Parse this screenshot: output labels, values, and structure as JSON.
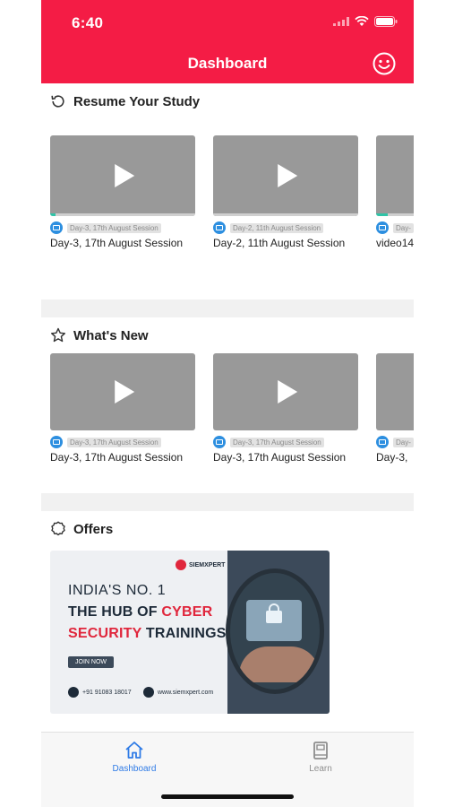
{
  "status_bar": {
    "time": "6:40"
  },
  "header": {
    "title": "Dashboard",
    "profile_icon": "smiley-icon"
  },
  "colors": {
    "header_bg": "#f41c45",
    "accent_blue": "#2f7be6",
    "progress": "#2fc4a7"
  },
  "resume": {
    "title": "Resume Your Study",
    "icon": "history-icon",
    "items": [
      {
        "tag": "Day-3, 17th August Session",
        "title": "Day-3, 17th August Session",
        "progress": 0.04
      },
      {
        "tag": "Day-2, 11th August Session",
        "title": "Day-2, 11th August Session",
        "progress": 0.0
      },
      {
        "tag": "Day-",
        "title": "video14",
        "progress": 0.08
      }
    ]
  },
  "whats_new": {
    "title": "What's New",
    "icon": "star-icon",
    "items": [
      {
        "tag": "Day-3, 17th August Session",
        "title": "Day-3, 17th August Session"
      },
      {
        "tag": "Day-3, 17th August Session",
        "title": "Day-3, 17th August Session"
      },
      {
        "tag": "Day-",
        "title": "Day-3,"
      }
    ]
  },
  "offers": {
    "title": "Offers",
    "icon": "badge-icon",
    "banner": {
      "brand": "SIEMXPERT",
      "line1": "INDIA'S NO. 1",
      "line2_a": "THE HUB OF ",
      "line2_b": "CYBER",
      "line3_a": "SECURITY",
      "line3_b": " TRAININGS",
      "cta": "JOIN NOW",
      "phone": "+91 91083 18017",
      "website": "www.siemxpert.com"
    }
  },
  "tabbar": {
    "tabs": [
      {
        "label": "Dashboard",
        "icon": "home-icon",
        "active": true
      },
      {
        "label": "Learn",
        "icon": "book-icon",
        "active": false
      }
    ]
  }
}
